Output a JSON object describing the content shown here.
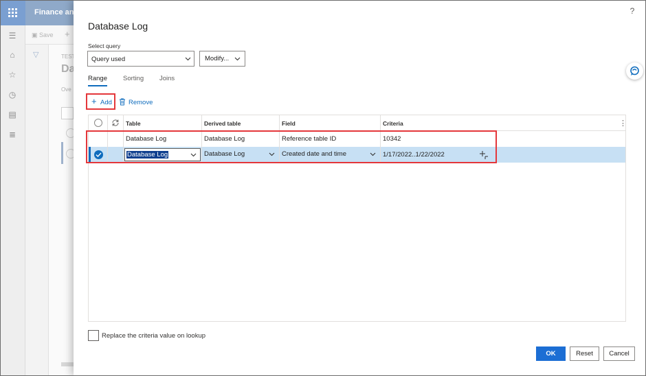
{
  "app": {
    "title": "Finance and",
    "toolbar": {
      "save_label": "Save"
    },
    "page": {
      "caption": "TEST",
      "heading": "Da",
      "tab_label": "Ove"
    },
    "nav_icons": [
      "hamburger-icon",
      "home-icon",
      "star-icon",
      "clock-icon",
      "workspace-icon",
      "list-icon"
    ]
  },
  "dialog": {
    "title": "Database Log",
    "select_query_label": "Select query",
    "query_value": "Query used",
    "modify_label": "Modify...",
    "tabs": [
      {
        "label": "Range",
        "active": true
      },
      {
        "label": "Sorting",
        "active": false
      },
      {
        "label": "Joins",
        "active": false
      }
    ],
    "actions": {
      "add_label": "Add",
      "remove_label": "Remove"
    },
    "grid": {
      "columns": [
        "Table",
        "Derived table",
        "Field",
        "Criteria"
      ],
      "rows": [
        {
          "table": "Database Log",
          "derived_table": "Database Log",
          "field": "Reference table ID",
          "criteria": "10342",
          "selected": false
        },
        {
          "table": "Database Log",
          "derived_table": "Database Log",
          "field": "Created date and time",
          "criteria": "1/17/2022..1/22/2022",
          "selected": true
        }
      ]
    },
    "lookup_checkbox_label": "Replace the criteria value on lookup",
    "buttons": {
      "ok": "OK",
      "reset": "Reset",
      "cancel": "Cancel"
    }
  },
  "colors": {
    "accent": "#0f6cbd",
    "highlight_outline": "#e4363a",
    "selected_row": "#c7e0f4",
    "topbar": "#8fa9c9"
  }
}
